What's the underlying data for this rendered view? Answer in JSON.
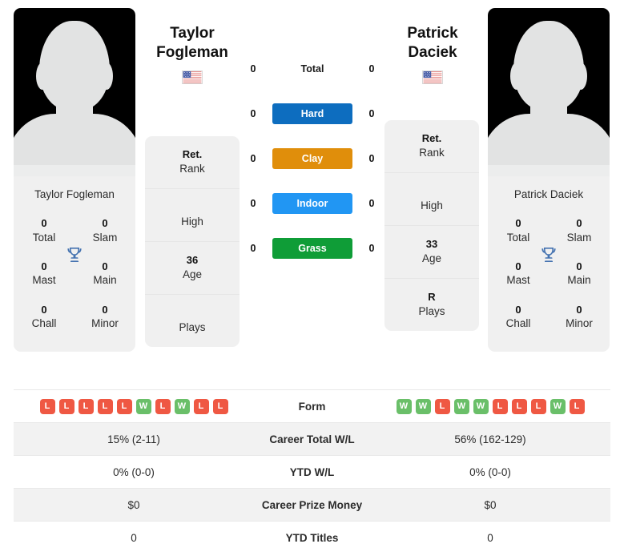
{
  "players": {
    "left": {
      "name": "Taylor Fogleman",
      "first_name": "Taylor",
      "last_name": "Fogleman",
      "country": "USA",
      "flag": "us-flag",
      "card_name": "Taylor Fogleman",
      "titles": [
        {
          "value": "0",
          "label": "Total"
        },
        {
          "value": "0",
          "label": "Slam"
        },
        {
          "value": "0",
          "label": "Mast"
        },
        {
          "value": "0",
          "label": "Main"
        },
        {
          "value": "0",
          "label": "Chall"
        },
        {
          "value": "0",
          "label": "Minor"
        }
      ],
      "info": [
        {
          "value": "Ret.",
          "label": "Rank"
        },
        {
          "value": "",
          "label": "High"
        },
        {
          "value": "36",
          "label": "Age"
        },
        {
          "value": "",
          "label": "Plays"
        }
      ],
      "form": [
        "L",
        "L",
        "L",
        "L",
        "L",
        "W",
        "L",
        "W",
        "L",
        "L"
      ],
      "stats": {
        "career_total_wl": "15% (2-11)",
        "ytd_wl": "0% (0-0)",
        "career_prize_money": "$0",
        "ytd_titles": "0"
      },
      "surface_counts": {
        "total": "0",
        "hard": "0",
        "clay": "0",
        "indoor": "0",
        "grass": "0"
      }
    },
    "right": {
      "name": "Patrick Daciek",
      "first_name": "Patrick",
      "last_name": "Daciek",
      "country": "USA",
      "flag": "us-flag",
      "card_name": "Patrick Daciek",
      "titles": [
        {
          "value": "0",
          "label": "Total"
        },
        {
          "value": "0",
          "label": "Slam"
        },
        {
          "value": "0",
          "label": "Mast"
        },
        {
          "value": "0",
          "label": "Main"
        },
        {
          "value": "0",
          "label": "Chall"
        },
        {
          "value": "0",
          "label": "Minor"
        }
      ],
      "info": [
        {
          "value": "Ret.",
          "label": "Rank"
        },
        {
          "value": "",
          "label": "High"
        },
        {
          "value": "33",
          "label": "Age"
        },
        {
          "value": "R",
          "label": "Plays"
        }
      ],
      "form": [
        "W",
        "W",
        "L",
        "W",
        "W",
        "L",
        "L",
        "L",
        "W",
        "L"
      ],
      "stats": {
        "career_total_wl": "56% (162-129)",
        "ytd_wl": "0% (0-0)",
        "career_prize_money": "$0",
        "ytd_titles": "0"
      },
      "surface_counts": {
        "total": "0",
        "hard": "0",
        "clay": "0",
        "indoor": "0",
        "grass": "0"
      }
    }
  },
  "surfaces": [
    {
      "key": "total",
      "label": "Total",
      "color": "transparent",
      "text_color": "#1a1a1a"
    },
    {
      "key": "hard",
      "label": "Hard",
      "color": "#0d6dbf",
      "text_color": "#ffffff"
    },
    {
      "key": "clay",
      "label": "Clay",
      "color": "#e08e0b",
      "text_color": "#ffffff"
    },
    {
      "key": "indoor",
      "label": "Indoor",
      "color": "#2196f3",
      "text_color": "#ffffff"
    },
    {
      "key": "grass",
      "label": "Grass",
      "color": "#0f9d37",
      "text_color": "#ffffff"
    }
  ],
  "stats_rows": [
    {
      "key": "form",
      "label": "Form"
    },
    {
      "key": "career_total_wl",
      "label": "Career Total W/L"
    },
    {
      "key": "ytd_wl",
      "label": "YTD W/L"
    },
    {
      "key": "career_prize_money",
      "label": "Career Prize Money"
    },
    {
      "key": "ytd_titles",
      "label": "YTD Titles"
    }
  ],
  "colors": {
    "win_badge": "#6abf69",
    "loss_badge": "#ef5843",
    "trophy": "#4472b0",
    "card_bg": "#f0f0f0",
    "row_alt_bg": "#f2f2f2"
  },
  "labels": {
    "win": "W",
    "loss": "L"
  }
}
